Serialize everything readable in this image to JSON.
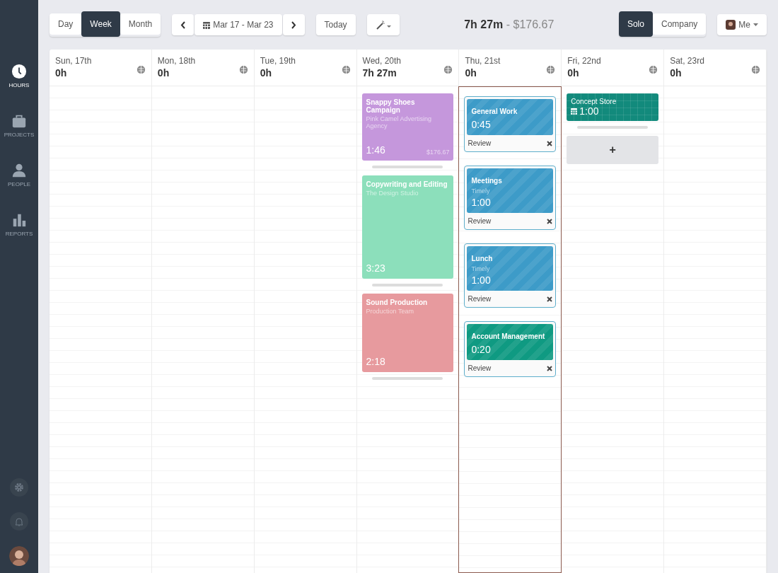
{
  "sidebar": {
    "items": [
      {
        "kind": "hours",
        "label": "HOURS",
        "selected": true
      },
      {
        "kind": "projects",
        "label": "PROJECTS",
        "selected": false
      },
      {
        "kind": "people",
        "label": "PEOPLE",
        "selected": false
      },
      {
        "kind": "reports",
        "label": "REPORTS",
        "selected": false
      }
    ]
  },
  "toolbar": {
    "views": [
      {
        "label": "Day",
        "selected": false
      },
      {
        "label": "Week",
        "selected": true
      },
      {
        "label": "Month",
        "selected": false
      }
    ],
    "date_range": "Mar 17 - Mar 23",
    "today": "Today",
    "summary": {
      "hours": "7h 27m",
      "amount": " - $176.67"
    },
    "scope": [
      {
        "label": "Solo",
        "selected": true
      },
      {
        "label": "Company",
        "selected": false
      }
    ],
    "user": "Me"
  },
  "days": [
    {
      "name": "Sun, 17th",
      "total": "0h",
      "selected": false
    },
    {
      "name": "Mon, 18th",
      "total": "0h",
      "selected": false
    },
    {
      "name": "Tue, 19th",
      "total": "0h",
      "selected": false
    },
    {
      "name": "Wed, 20th",
      "total": "7h 27m",
      "selected": false,
      "entries": [
        {
          "kind": "entry",
          "title": "Snappy Shoes Campaign",
          "client": "Pink Camel Advertising Agency",
          "duration": "1:46",
          "amount": "$176.67",
          "color": "#c597dc"
        },
        {
          "kind": "entry",
          "title": "Copywriting and Editing",
          "client": "The Design Studio",
          "duration": "3:23",
          "color": "#8cdfbb"
        },
        {
          "kind": "entry",
          "title": "Sound Production",
          "client": "Production Team",
          "duration": "2:18",
          "color": "#e79a9e"
        }
      ]
    },
    {
      "name": "Thu, 21st",
      "total": "0h",
      "selected": true,
      "entries": [
        {
          "kind": "review",
          "title": "General Work",
          "duration": "0:45",
          "action": "Review",
          "color": "#3d9bc8"
        },
        {
          "kind": "review",
          "title": "Meetings",
          "client": "Timely",
          "duration": "1:00",
          "action": "Review",
          "color": "#3d9bc8"
        },
        {
          "kind": "review",
          "title": "Lunch",
          "client": "Timely",
          "duration": "1:00",
          "action": "Review",
          "color": "#3d9bc8"
        },
        {
          "kind": "review",
          "title": "Account Management",
          "duration": "0:20",
          "action": "Review",
          "color": "#0f9a82"
        }
      ]
    },
    {
      "name": "Fri, 22nd",
      "total": "0h",
      "selected": false,
      "entries": [
        {
          "kind": "planned",
          "title": "Concept Store",
          "duration": "1:00",
          "color": "#128a7c"
        },
        {
          "kind": "add",
          "label": "+"
        }
      ]
    },
    {
      "name": "Sat, 23rd",
      "total": "0h",
      "selected": false
    }
  ]
}
